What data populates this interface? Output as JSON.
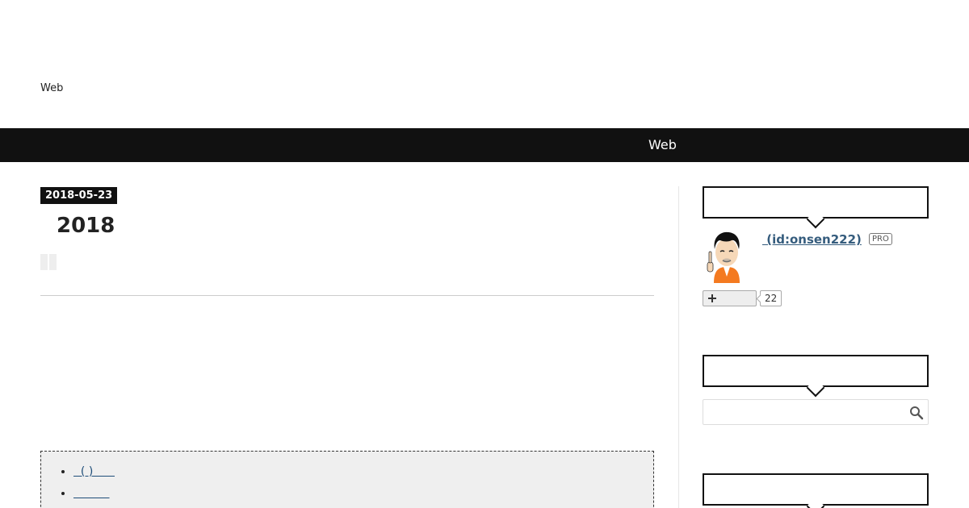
{
  "header": {
    "site_description": "Web"
  },
  "nav": {
    "link_label": "Web"
  },
  "entry": {
    "date": "2018-05-23",
    "title": "2018",
    "share_icon": "share-icon"
  },
  "toc": {
    "items": [
      {
        "label": "  ( )      "
      },
      {
        "label": "          "
      }
    ]
  },
  "sidebar": {
    "profile": {
      "name_link": " (id:onsen222)",
      "badge": "PRO",
      "follow_icon": "plus-icon",
      "follower_count": "22"
    },
    "search": {
      "placeholder": "",
      "icon": "search-icon"
    }
  },
  "colors": {
    "navbar_bg": "#111111",
    "link": "#1f4e79",
    "toc_bg": "#efefef"
  }
}
